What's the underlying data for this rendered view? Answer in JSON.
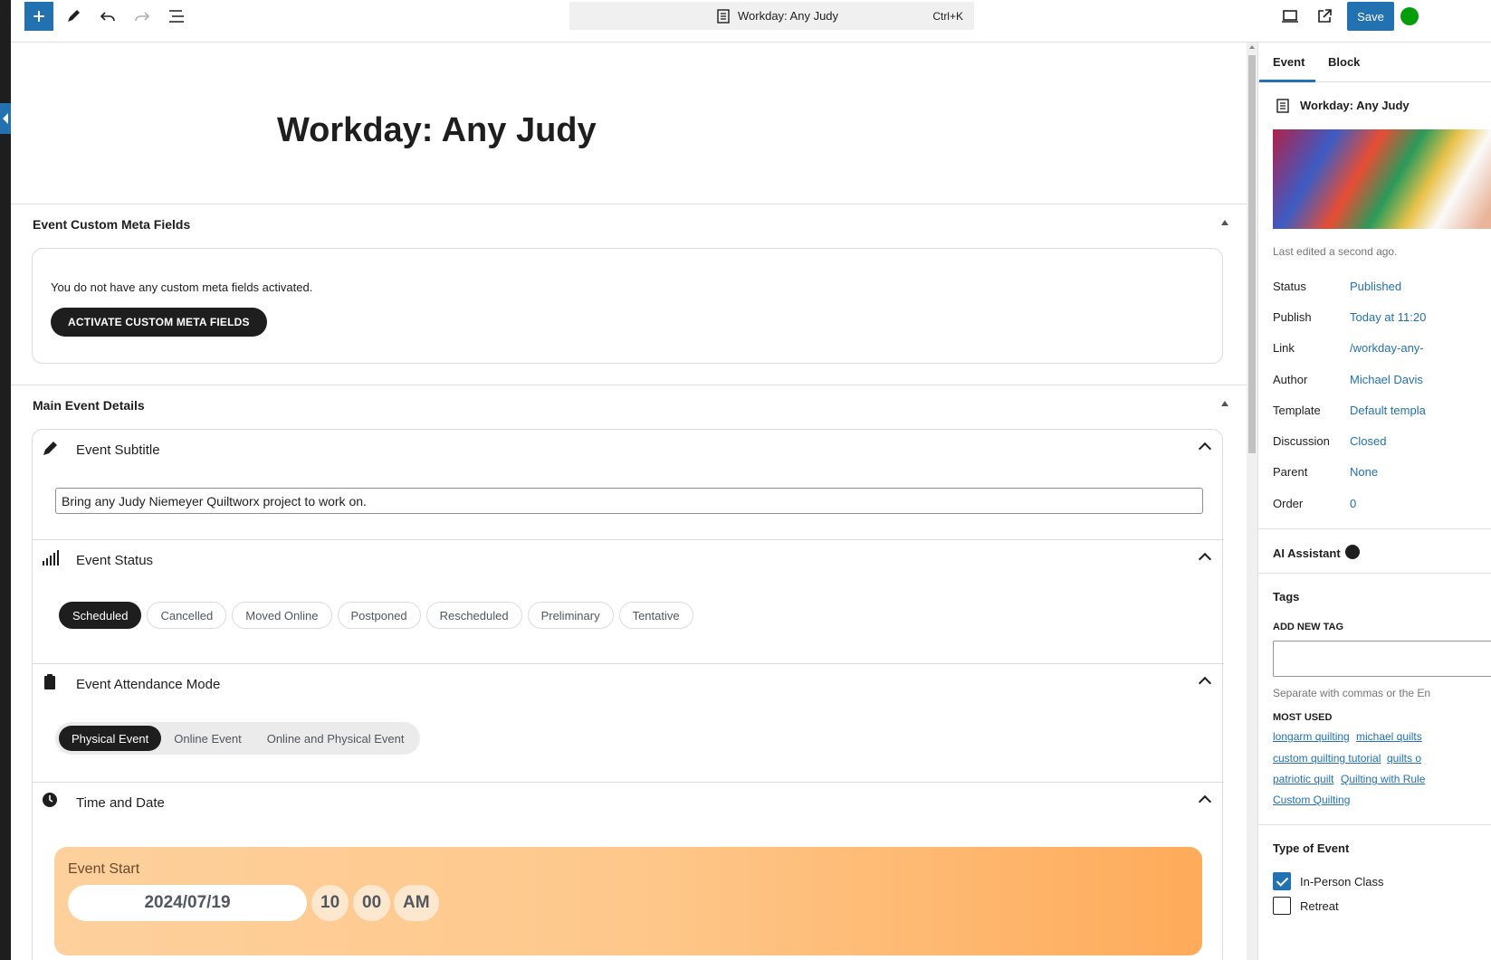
{
  "toolbar": {
    "document_title": "Workday: Any Judy",
    "shortcut": "Ctrl+K",
    "save_label": "Save"
  },
  "post": {
    "title": "Workday: Any Judy"
  },
  "custom_meta": {
    "header": "Event Custom Meta Fields",
    "note": "You do not have any custom meta fields activated.",
    "button": "ACTIVATE CUSTOM META FIELDS"
  },
  "main_details": {
    "header": "Main Event Details",
    "subtitle": {
      "label": "Event Subtitle",
      "value": "Bring any Judy Niemeyer Quiltworx project to work on."
    },
    "status": {
      "label": "Event Status",
      "options": [
        "Scheduled",
        "Cancelled",
        "Moved Online",
        "Postponed",
        "Rescheduled",
        "Preliminary",
        "Tentative"
      ],
      "selected": "Scheduled"
    },
    "attendance": {
      "label": "Event Attendance Mode",
      "options": [
        "Physical Event",
        "Online Event",
        "Online and Physical Event"
      ],
      "selected": "Physical Event"
    },
    "time_date": {
      "label": "Time and Date",
      "start_label": "Event Start",
      "date": "2024/07/19",
      "hour": "10",
      "minute": "00",
      "ampm": "AM"
    }
  },
  "sidebar": {
    "tabs": [
      "Event",
      "Block"
    ],
    "post_title": "Workday: Any Judy",
    "last_edited": "Last edited a second ago.",
    "rows": [
      {
        "label": "Status",
        "value": "Published"
      },
      {
        "label": "Publish",
        "value": "Today at 11:20"
      },
      {
        "label": "Link",
        "value": "/workday-any-"
      },
      {
        "label": "Author",
        "value": "Michael Davis"
      },
      {
        "label": "Template",
        "value": "Default templa"
      },
      {
        "label": "Discussion",
        "value": "Closed"
      },
      {
        "label": "Parent",
        "value": "None"
      },
      {
        "label": "Order",
        "value": "0"
      }
    ],
    "ai_assistant": "AI Assistant",
    "tags": {
      "header": "Tags",
      "add_new": "ADD NEW TAG",
      "help": "Separate with commas or the En",
      "most_used": "MOST USED",
      "items": [
        "longarm quilting",
        "michael quilts",
        "custom quilting tutorial",
        "quilts o",
        "patriotic quilt",
        "Quilting with Rule",
        "Custom Quilting"
      ]
    },
    "type_of_event": {
      "header": "Type of Event",
      "options": [
        {
          "label": "In-Person Class",
          "checked": true
        },
        {
          "label": "Retreat",
          "checked": false
        }
      ]
    }
  },
  "colors": {
    "accent": "#2271b1",
    "dark": "#1e1e1e"
  }
}
